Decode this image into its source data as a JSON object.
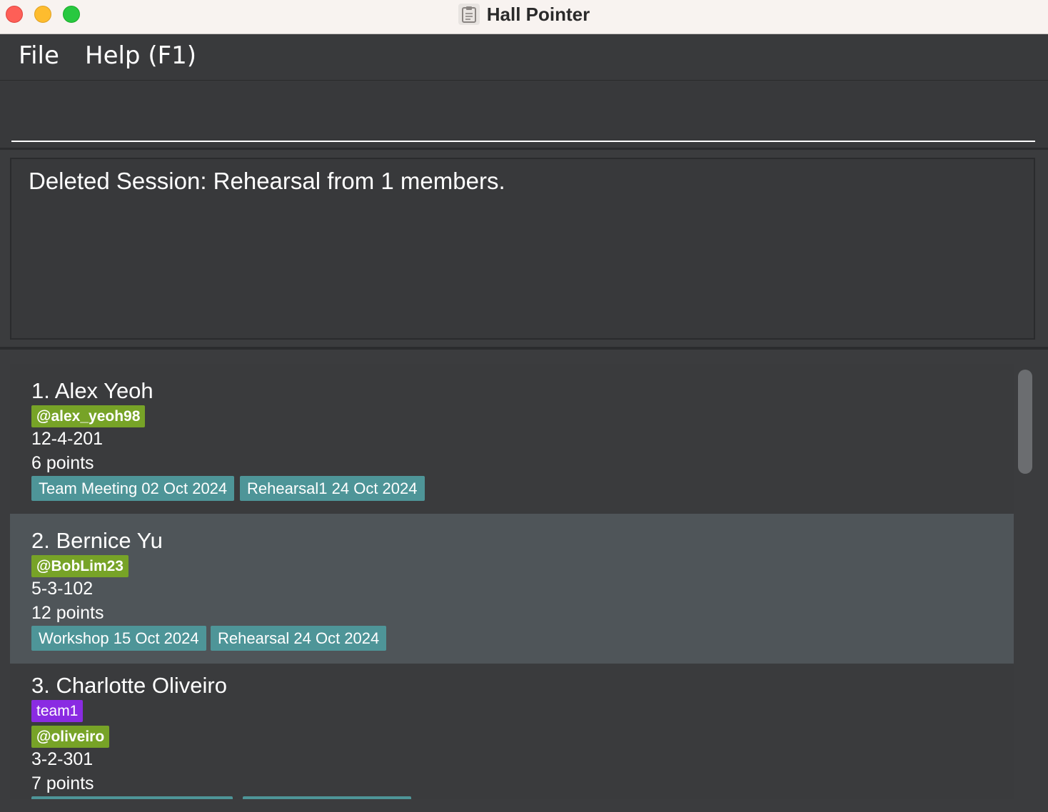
{
  "window": {
    "title": "Hall Pointer",
    "icon": "clipboard-icon"
  },
  "menu": {
    "file": "File",
    "help": "Help (F1)"
  },
  "command": {
    "value": "",
    "placeholder": ""
  },
  "result": {
    "message": "Deleted Session: Rehearsal from 1 members."
  },
  "members": [
    {
      "name": "1. Alex Yeoh",
      "handle": "@alex_yeoh98",
      "room": "12-4-201",
      "points": "6 points",
      "sessions": [
        "Team Meeting 02 Oct 2024",
        "Rehearsal1 24 Oct 2024"
      ]
    },
    {
      "name": "2. Bernice Yu",
      "handle": "@BobLim23",
      "room": "5-3-102",
      "points": "12 points",
      "sessions": [
        "Workshop 15 Oct 2024",
        "Rehearsal 24 Oct 2024"
      ]
    },
    {
      "name": "3. Charlotte Oliveiro",
      "tag": "team1",
      "handle": "@oliveiro",
      "room": "3-2-301",
      "points": "7 points",
      "sessions": []
    }
  ],
  "colors": {
    "handle_tag": "#77a327",
    "team_tag": "#8a2be2",
    "session_tag": "#4e9598",
    "selected_row": "#4f5559"
  }
}
